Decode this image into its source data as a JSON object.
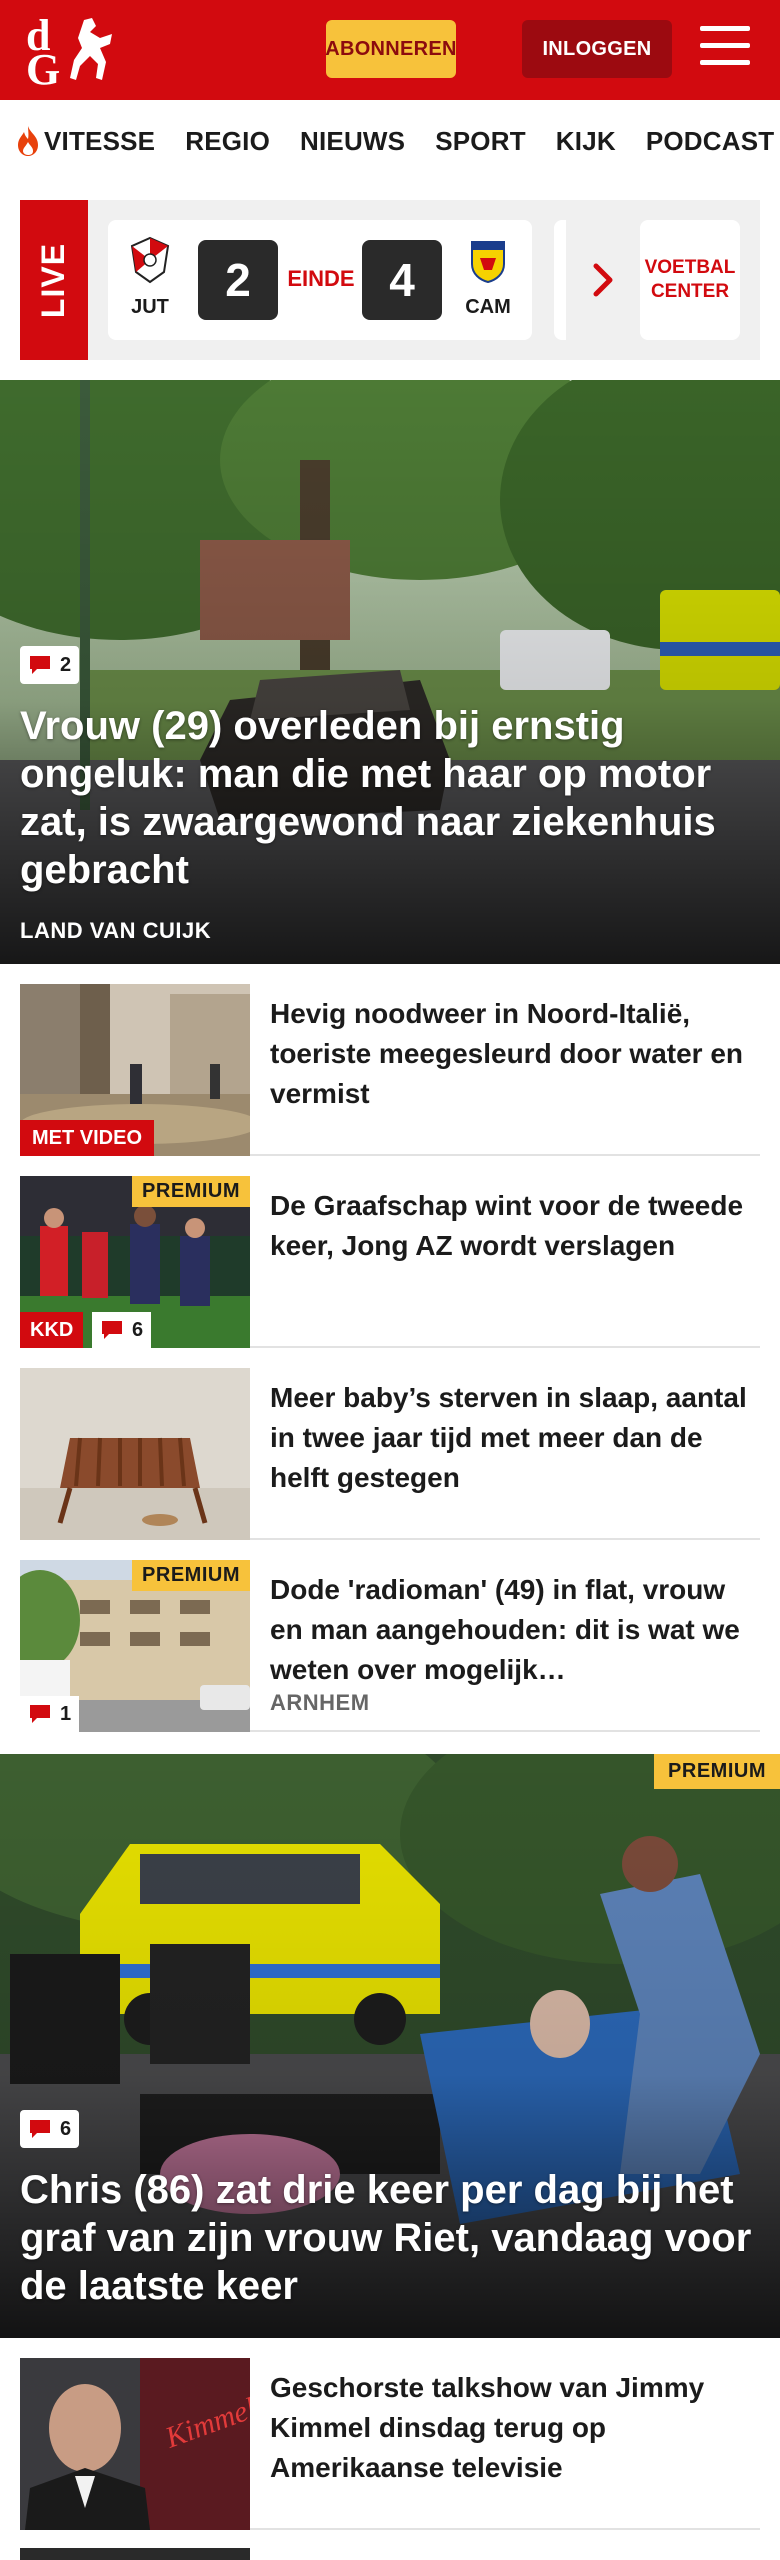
{
  "header": {
    "logo_top": "d",
    "logo_bottom": "G",
    "subscribe_label": "ABONNEREN",
    "login_label": "INLOGGEN"
  },
  "nav": {
    "items": [
      {
        "label": "VITESSE",
        "icon": "flame-icon"
      },
      {
        "label": "REGIO"
      },
      {
        "label": "NIEUWS"
      },
      {
        "label": "SPORT"
      },
      {
        "label": "KIJK"
      },
      {
        "label": "PODCAST"
      }
    ]
  },
  "live": {
    "label": "LIVE",
    "home_team": "JUT",
    "home_score": "2",
    "status": "EINDE",
    "away_score": "4",
    "away_team": "CAM",
    "cta": "VOETBAL CENTER"
  },
  "hero": {
    "comments": "2",
    "title": "Vrouw (29) overleden bij ernstig ongeluk: man die met haar op motor zat, is zwaargewond naar ziekenhuis gebracht",
    "location": "LAND VAN CUIJK"
  },
  "articles": [
    {
      "title": "Hevig noodweer in Noord-Italië, toeriste meegesleurd door water en vermist",
      "tag": "MET VIDEO"
    },
    {
      "title": "De Graafschap wint voor de tweede keer, Jong AZ wordt verslagen",
      "premium": "PREMIUM",
      "tag": "KKD",
      "comments": "6"
    },
    {
      "title": "Meer baby’s sterven in slaap, aantal in twee jaar tijd met meer dan de helft gestegen"
    },
    {
      "title": "Dode 'radioman' (49) in flat, vrouw en man aangehouden: dit is wat we weten over mogelijk…",
      "premium": "PREMIUM",
      "comments": "1",
      "location": "ARNHEM"
    }
  ],
  "hero2": {
    "premium": "PREMIUM",
    "comments": "6",
    "title": "Chris (86) zat drie keer per dag bij het graf van zijn vrouw Riet, vandaag voor de laatste keer"
  },
  "articles2": [
    {
      "title": "Geschorste talkshow van Jimmy Kimmel dinsdag terug op Amerikaanse televisie"
    }
  ],
  "colors": {
    "brand_red": "#d20a0f",
    "premium_yellow": "#f7c23b",
    "dark_red": "#9c0a10"
  }
}
